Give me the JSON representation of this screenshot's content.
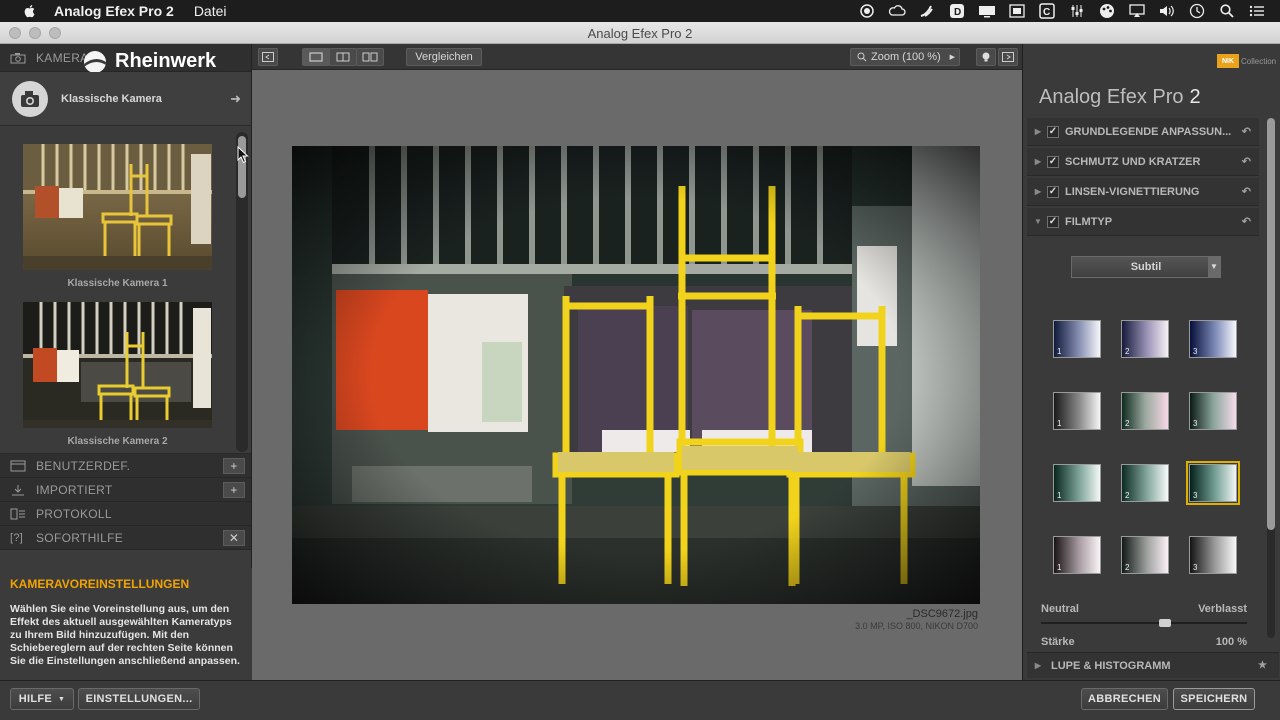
{
  "menubar": {
    "app_name": "Analog Efex Pro 2",
    "menu_datei": "Datei"
  },
  "window": {
    "title": "Analog Efex Pro 2"
  },
  "left_panel": {
    "kamera_label": "KAMERA",
    "logo_text": "Rheinwerk",
    "camera_type": "Klassische Kamera",
    "presets": [
      {
        "label": "Klassische Kamera 1"
      },
      {
        "label": "Klassische Kamera 2"
      }
    ],
    "sections": {
      "benutzerdef": "BENUTZERDEF.",
      "importiert": "IMPORTIERT",
      "protokoll": "PROTOKOLL",
      "soforthilfe": "SOFORTHILFE"
    },
    "help": {
      "heading": "KAMERAVOREINSTELLUNGEN",
      "text": "Wählen Sie eine Voreinstellung aus, um den Effekt des aktuell ausgewählten Kameratyps zu Ihrem Bild hinzuzufügen. Mit den Schiebereglern auf der rechten Seite können Sie die Einstellungen anschließend anpassen."
    }
  },
  "toolbar": {
    "compare_label": "Vergleichen",
    "zoom_label": "Zoom (100 %)"
  },
  "image": {
    "filename": "_DSC9672.jpg",
    "meta": "3.0 MP, ISO 800, NIKON D700"
  },
  "right_panel": {
    "brand_box": "NIK",
    "brand_collection": "Collection",
    "title": "Analog Efex Pro",
    "title_num": "2",
    "filters": [
      {
        "label": "GRUNDLEGENDE ANPASSUN...",
        "checked": true,
        "expanded": false
      },
      {
        "label": "SCHMUTZ UND KRATZER",
        "checked": true,
        "expanded": false
      },
      {
        "label": "LINSEN-VIGNETTIERUNG",
        "checked": true,
        "expanded": false
      },
      {
        "label": "FILMTYP",
        "checked": true,
        "expanded": true
      }
    ],
    "film_dropdown": "Subtil",
    "swatch_numbers": [
      "1",
      "2",
      "3"
    ],
    "selected_swatch": {
      "row": 3,
      "col": 3
    },
    "slider": {
      "left_label": "Neutral",
      "right_label": "Verblasst",
      "value_fraction": 0.6,
      "strength_label": "Stärke",
      "strength_value": "100 %"
    },
    "lupe_label": "LUPE & HISTOGRAMM"
  },
  "bottom_bar": {
    "help_label": "HILFE",
    "settings_label": "EINSTELLUNGEN...",
    "cancel_label": "ABBRECHEN",
    "save_label": "SPEICHERN"
  },
  "colors": {
    "accent_orange": "#f2a300",
    "selection_yellow": "#e0b000",
    "panel_bg": "#3a3a3a",
    "canvas_bg": "#6a6a6a"
  }
}
